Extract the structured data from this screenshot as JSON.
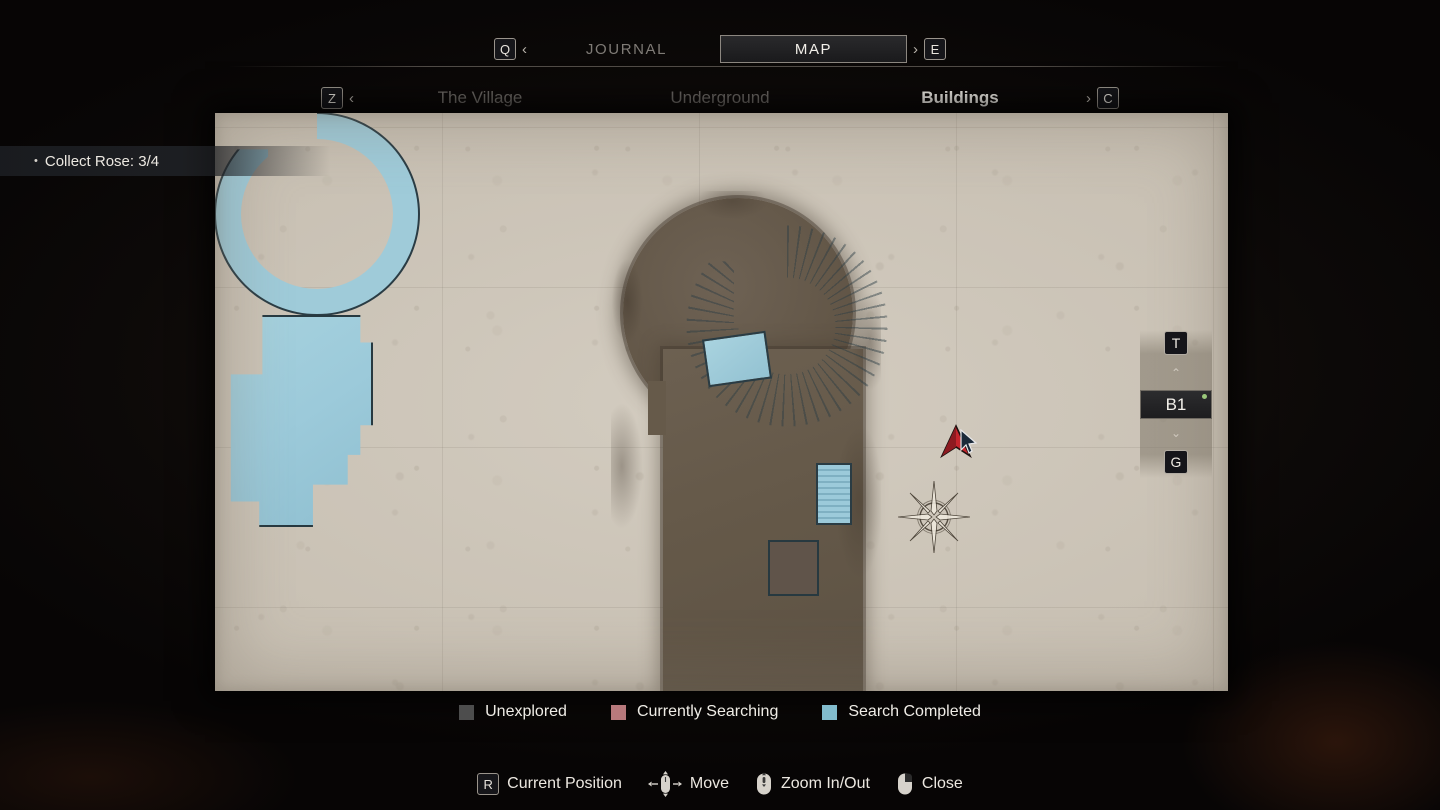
{
  "screen": {
    "title": "Map Screen",
    "accent_white": "#f2efe9",
    "accent_dim": "#7f7b76"
  },
  "top_tabs": {
    "prev_key": "Q",
    "prev_arrow": "‹",
    "next_arrow": "›",
    "next_key": "E",
    "items": [
      {
        "label": "JOURNAL",
        "active": false
      },
      {
        "label": "MAP",
        "active": true
      }
    ]
  },
  "area_tabs": {
    "prev_key": "Z",
    "prev_arrow": "‹",
    "next_arrow": "›",
    "next_key": "C",
    "items": [
      {
        "label": "The Village",
        "active": false
      },
      {
        "label": "Underground",
        "active": false
      },
      {
        "label": "Buildings",
        "active": true
      }
    ]
  },
  "objective": {
    "bullet": "•",
    "text": "Collect Rose: 3/4"
  },
  "floor_selector": {
    "up_key": "T",
    "up_arrow": "⌃",
    "current": "B1",
    "down_arrow": "⌄",
    "down_key": "G",
    "marker_color": "#9ac77a"
  },
  "legend": {
    "items": [
      {
        "label": "Unexplored",
        "color": "#4d4d4d",
        "icon": "square-swatch"
      },
      {
        "label": "Currently Searching",
        "color": "#b8797c",
        "icon": "square-swatch"
      },
      {
        "label": "Search Completed",
        "color": "#82bccd",
        "icon": "square-swatch"
      }
    ]
  },
  "hints": [
    {
      "key": "R",
      "icon": "key-badge",
      "label": "Current Position"
    },
    {
      "key": "",
      "icon": "mouse-move-icon",
      "label": "Move"
    },
    {
      "key": "",
      "icon": "mouse-scroll-icon",
      "label": "Zoom In/Out"
    },
    {
      "key": "",
      "icon": "mouse-rightclick-icon",
      "label": "Close"
    }
  ],
  "map": {
    "paper_color": "#c8c0b3",
    "unexplored_color": "#635748",
    "explored_color": "#9fcbd9",
    "ink_color": "#2a3c44",
    "player_marker_color": "#c4242c",
    "features": [
      {
        "name": "spiral-staircase",
        "state": "explored"
      },
      {
        "name": "stair-landing",
        "state": "explored"
      },
      {
        "name": "main-hall",
        "state": "unexplored"
      },
      {
        "name": "large-room",
        "state": "explored"
      },
      {
        "name": "inner-courtyard",
        "state": "unexplored"
      },
      {
        "name": "room-stairs",
        "state": "explored"
      },
      {
        "name": "compass-rose",
        "state": "decor"
      },
      {
        "name": "emblem-illustration",
        "state": "decor"
      }
    ]
  }
}
